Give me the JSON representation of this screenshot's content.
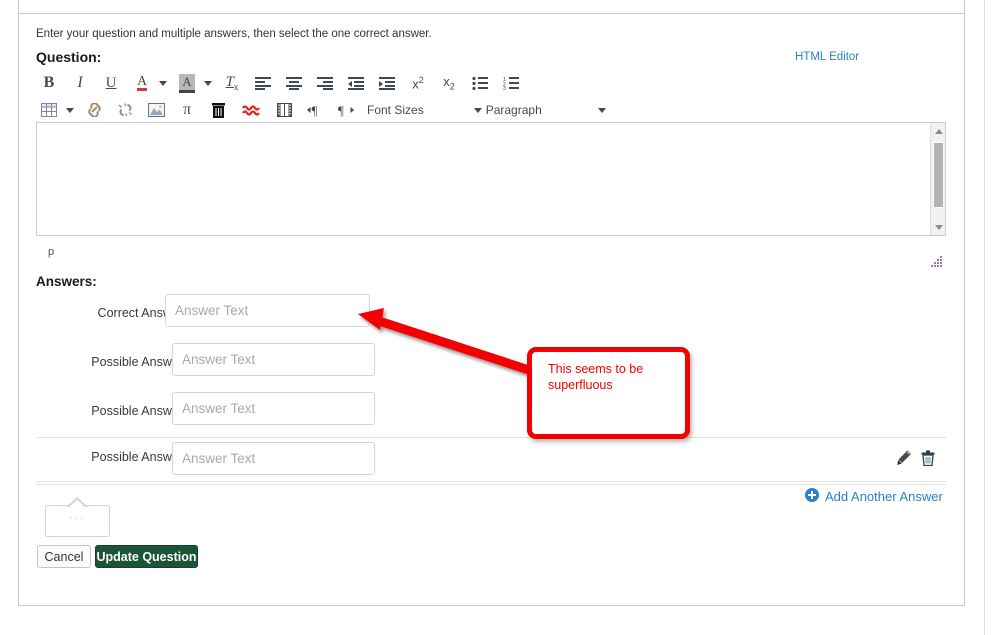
{
  "page": {
    "intro": "Enter your question and multiple answers, then select the one correct answer.",
    "question_label": "Question:",
    "answers_label": "Answers:",
    "html_editor_link": "HTML Editor"
  },
  "editor": {
    "content": "",
    "status_path": "p",
    "toolbar_row1": [
      {
        "name": "bold-icon",
        "glyph": "B",
        "kind": "bold"
      },
      {
        "name": "italic-icon",
        "glyph": "I",
        "kind": "italic"
      },
      {
        "name": "underline-icon",
        "glyph": "U",
        "kind": "underline"
      },
      {
        "name": "text-color-icon",
        "glyph": "A",
        "kind": "textcolor"
      },
      {
        "name": "highlight-color-icon",
        "glyph": "A",
        "kind": "highlight"
      },
      {
        "name": "remove-formatting-icon",
        "glyph": "Tx",
        "kind": "removeformat"
      },
      {
        "name": "align-left-icon",
        "glyph": "",
        "kind": "alignleft"
      },
      {
        "name": "align-center-icon",
        "glyph": "",
        "kind": "aligncenter"
      },
      {
        "name": "align-right-icon",
        "glyph": "",
        "kind": "alignright"
      },
      {
        "name": "outdent-icon",
        "glyph": "",
        "kind": "outdent"
      },
      {
        "name": "indent-icon",
        "glyph": "",
        "kind": "indent"
      },
      {
        "name": "superscript-icon",
        "glyph": "x2",
        "kind": "superscript"
      },
      {
        "name": "subscript-icon",
        "glyph": "x2",
        "kind": "subscript"
      },
      {
        "name": "bulleted-list-icon",
        "glyph": "",
        "kind": "ullist"
      },
      {
        "name": "numbered-list-icon",
        "glyph": "",
        "kind": "ollist"
      }
    ],
    "toolbar_row2": [
      {
        "name": "table-icon",
        "glyph": "",
        "kind": "table"
      },
      {
        "name": "link-icon",
        "glyph": "",
        "kind": "link"
      },
      {
        "name": "unlink-icon",
        "glyph": "",
        "kind": "unlink"
      },
      {
        "name": "image-icon",
        "glyph": "",
        "kind": "image"
      },
      {
        "name": "math-equation-icon",
        "glyph": "π",
        "kind": "math"
      },
      {
        "name": "delete-icon",
        "glyph": "",
        "kind": "trash"
      },
      {
        "name": "spellcheck-icon",
        "glyph": "≈",
        "kind": "spellcheck"
      },
      {
        "name": "media-icon",
        "glyph": "",
        "kind": "media"
      },
      {
        "name": "paragraph-ltr-icon",
        "glyph": "¶",
        "kind": "ltr"
      },
      {
        "name": "paragraph-rtl-icon",
        "glyph": "¶",
        "kind": "rtl"
      }
    ],
    "font_sizes_label": "Font Sizes",
    "paragraph_label": "Paragraph"
  },
  "answers": {
    "placeholder": "Answer Text",
    "rows": [
      {
        "label": "Correct Answer",
        "value": "",
        "wide": true,
        "hovered": false
      },
      {
        "label": "Possible Answer",
        "value": "",
        "wide": false,
        "hovered": false
      },
      {
        "label": "Possible Answer",
        "value": "",
        "wide": false,
        "hovered": false
      },
      {
        "label": "Possible Answer",
        "value": "",
        "wide": false,
        "hovered": true
      }
    ],
    "edit_icon": "pencil-icon",
    "delete_icon": "trash-icon",
    "add_another_label": "Add Another Answer"
  },
  "stray_element": {
    "dots": "···"
  },
  "footer": {
    "cancel_label": "Cancel",
    "update_label": "Update Question"
  },
  "annotation": {
    "text": "This seems to be superfluous",
    "color": "#f40000"
  },
  "colors": {
    "link_blue": "#2d80c4",
    "primary_green": "#1c5438",
    "annotation_red": "#f40000",
    "field_border": "#d6d6d6"
  }
}
